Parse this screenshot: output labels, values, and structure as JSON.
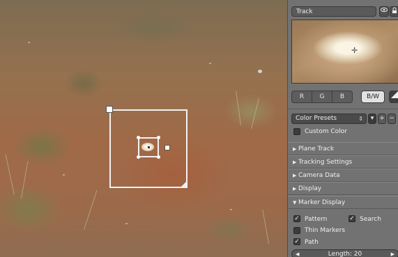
{
  "track_panel": {
    "header_label": "Track",
    "eye_icon": "eye-icon",
    "lock_icon": "lock-icon"
  },
  "preview": {
    "crosshair_icon": "crosshair-icon"
  },
  "channels": {
    "r": "R",
    "g": "G",
    "b": "B",
    "bw": "B/W"
  },
  "color_presets": {
    "label": "Color Presets",
    "add": "+",
    "remove": "−"
  },
  "custom_color": {
    "label": "Custom Color",
    "checked": false
  },
  "sections": [
    {
      "label": "Plane Track",
      "expanded": false
    },
    {
      "label": "Tracking Settings",
      "expanded": false
    },
    {
      "label": "Camera Data",
      "expanded": false
    },
    {
      "label": "Display",
      "expanded": false
    },
    {
      "label": "Marker Display",
      "expanded": true
    }
  ],
  "marker_display": {
    "pattern": {
      "label": "Pattern",
      "checked": true
    },
    "search": {
      "label": "Search",
      "checked": true
    },
    "thin_markers": {
      "label": "Thin Markers",
      "checked": false
    },
    "path": {
      "label": "Path",
      "checked": true
    },
    "length_label": "Length: 20"
  },
  "colors": {
    "panel_bg": "#727272",
    "marker_outline": "#f2f2f2",
    "bw_active": "#e2e2e2"
  }
}
